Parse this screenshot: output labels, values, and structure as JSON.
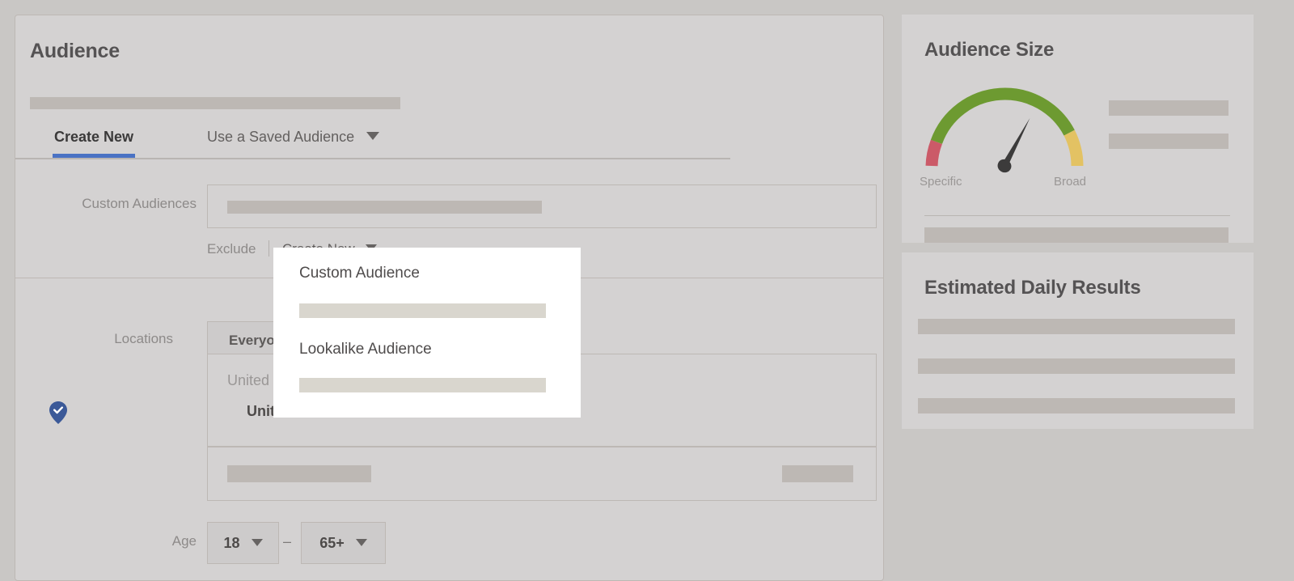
{
  "main": {
    "title": "Audience",
    "tabs": [
      {
        "label": "Create New",
        "active": true
      },
      {
        "label": "Use a Saved Audience",
        "active": false
      }
    ],
    "custom_audiences": {
      "label": "Custom Audiences",
      "exclude_label": "Exclude",
      "create_new_label": "Create New"
    },
    "locations": {
      "label": "Locations",
      "scope_chip": "Everyone in this location",
      "box_title": "United States",
      "selected_item": "United States",
      "pin_icon": "map-pin-check-icon"
    },
    "age": {
      "label": "Age",
      "min": "18",
      "dash": "–",
      "max": "65+"
    }
  },
  "dropdown": {
    "items": [
      {
        "label": "Custom Audience"
      },
      {
        "label": "Lookalike Audience"
      }
    ]
  },
  "audience_size": {
    "title": "Audience Size",
    "gauge": {
      "left_label": "Specific",
      "right_label": "Broad",
      "needle_angle_deg": 28,
      "segments": [
        {
          "name": "specific",
          "color": "#cb5a68",
          "start_deg": 180,
          "end_deg": 208
        },
        {
          "name": "balanced",
          "color": "#6d9a31",
          "start_deg": 208,
          "end_deg": 333
        },
        {
          "name": "broad",
          "color": "#e3c263",
          "start_deg": 333,
          "end_deg": 360
        }
      ],
      "needle_color": "#3c3b3b"
    }
  },
  "estimated_daily_results": {
    "title": "Estimated Daily Results"
  },
  "colors": {
    "page_background": "#c9c7c5",
    "panel_background": "#d4d2d2",
    "panel_border": "#bdb8b4",
    "skeleton": "#bdb8b4",
    "dropdown_background": "#ffffff",
    "dropdown_skeleton": "#d9d6ce",
    "active_tab_underline": "#4a72c4",
    "pin_blue": "#3b5998",
    "heading_text": "#555354",
    "muted_text": "#8d8a89"
  }
}
